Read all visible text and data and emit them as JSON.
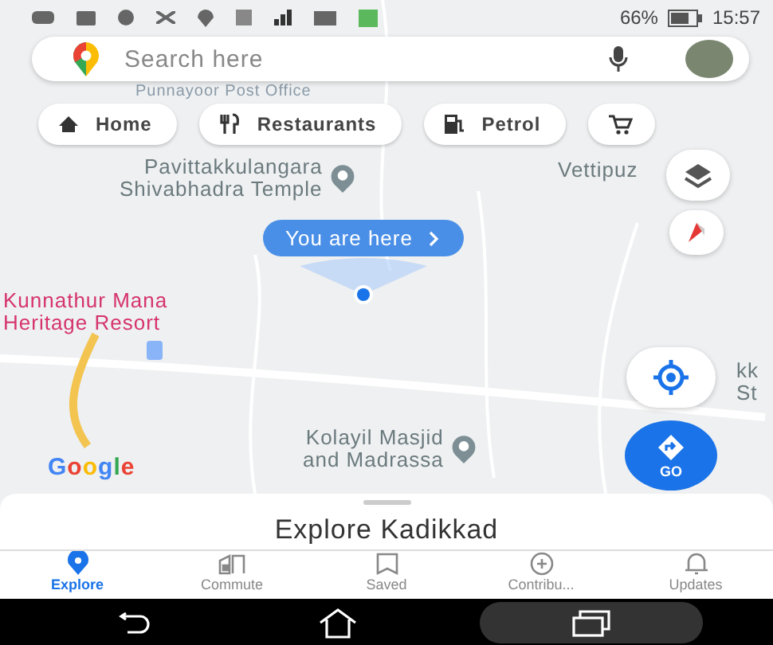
{
  "status_bar": {
    "battery": "66%",
    "time": "15:57"
  },
  "search": {
    "placeholder": "Search here"
  },
  "chips": [
    {
      "label": "Home",
      "kind": "home"
    },
    {
      "label": "Restaurants",
      "kind": "restaurant"
    },
    {
      "label": "Petrol",
      "kind": "fuel"
    },
    {
      "kind": "cart"
    }
  ],
  "map": {
    "places": [
      {
        "lines": [
          "Punnayoor Post Office"
        ],
        "kind": "faded"
      },
      {
        "lines": [
          "Pavittakkulangara",
          "Shivabhadra Temple"
        ],
        "kind": "temple"
      },
      {
        "lines": [
          "Vettipuz"
        ],
        "kind": "plain"
      },
      {
        "lines": [
          "Kunnathur Mana",
          "Heritage Resort"
        ],
        "kind": "resort"
      },
      {
        "lines": [
          "Kolayil Masjid",
          "and Madrassa"
        ],
        "kind": "mosque"
      },
      {
        "lines": [
          "kk",
          "St"
        ],
        "kind": "plain"
      }
    ],
    "you_are_here": "You are here",
    "go_button": "GO",
    "logo": "Google"
  },
  "sheet": {
    "title": "Explore Kadikkad"
  },
  "nav": [
    {
      "label": "Explore",
      "kind": "explore",
      "selected": true
    },
    {
      "label": "Commute",
      "kind": "commute",
      "selected": false
    },
    {
      "label": "Saved",
      "kind": "saved",
      "selected": false
    },
    {
      "label": "Contribu...",
      "kind": "contribute",
      "selected": false
    },
    {
      "label": "Updates",
      "kind": "updates",
      "selected": false
    }
  ]
}
